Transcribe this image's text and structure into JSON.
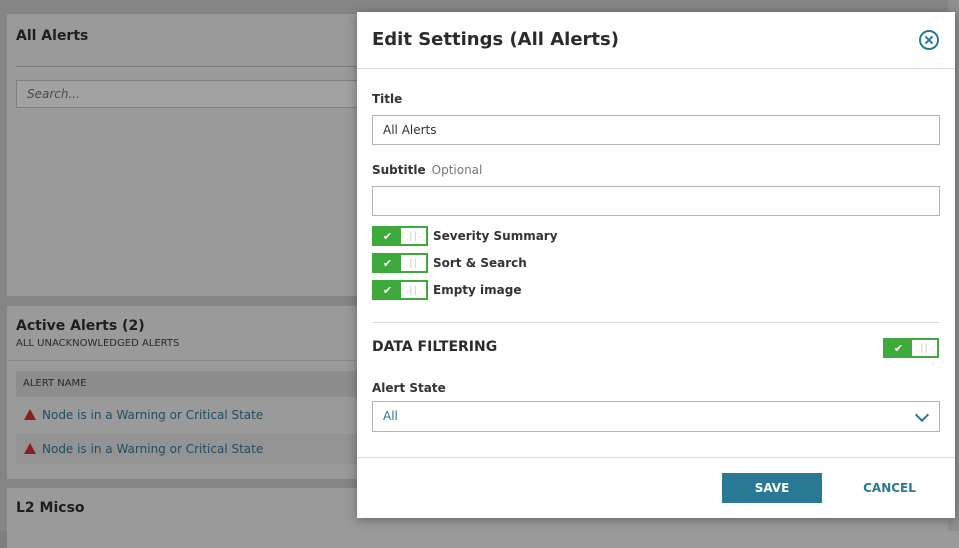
{
  "background": {
    "panel1_title": "All Alerts",
    "search_placeholder": "Search...",
    "panel2_title": "Active Alerts (2)",
    "panel2_subtitle": "ALL UNACKNOWLEDGED ALERTS",
    "column_header": "ALERT NAME",
    "alerts": [
      "Node is in a Warning or Critical State",
      "Node is in a Warning or Critical State"
    ],
    "panel3_title": "L2 Micso"
  },
  "modal": {
    "title": "Edit Settings (All Alerts)",
    "title_label": "Title",
    "title_value": "All Alerts",
    "subtitle_label": "Subtitle",
    "subtitle_optional": "Optional",
    "subtitle_value": "",
    "toggles": [
      {
        "label": "Severity Summary",
        "on": true
      },
      {
        "label": "Sort & Search",
        "on": true
      },
      {
        "label": "Empty image",
        "on": true
      }
    ],
    "data_filtering_label": "DATA FILTERING",
    "data_filtering_on": true,
    "alert_state_label": "Alert State",
    "alert_state_value": "All",
    "save_label": "SAVE",
    "cancel_label": "CANCEL"
  },
  "colors": {
    "accent": "#297994",
    "toggle_on": "#3faa3c",
    "warning": "#8b1f1f"
  },
  "icons": {
    "close": "close-circle-icon",
    "check": "check-icon",
    "chevron": "chevron-down-icon",
    "warning": "warning-triangle-icon"
  }
}
